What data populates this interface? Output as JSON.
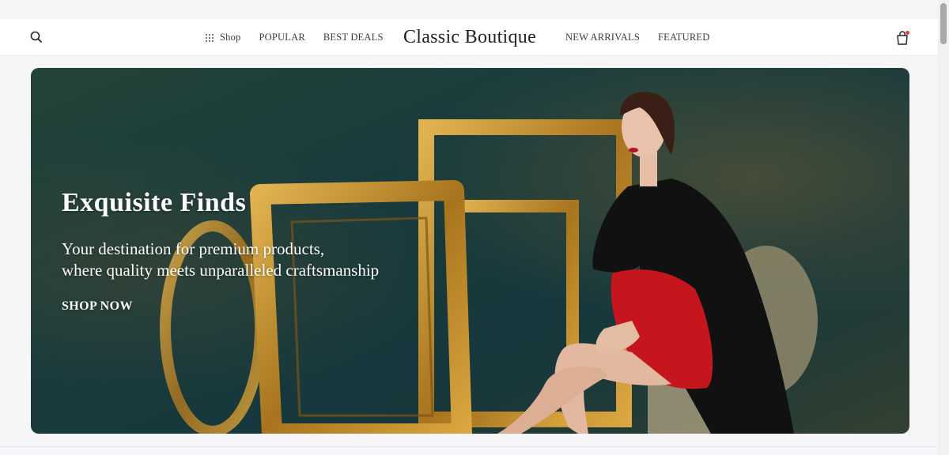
{
  "header": {
    "logo": "Classic Boutique",
    "nav_left": [
      {
        "label": "Shop",
        "icon": "grid-icon"
      },
      {
        "label": "POPULAR"
      },
      {
        "label": "BEST DEALS"
      }
    ],
    "nav_right": [
      {
        "label": "NEW ARRIVALS"
      },
      {
        "label": "FEATURED"
      }
    ],
    "search_icon": "search-icon",
    "cart_icon": "shopping-bag-icon",
    "cart_badge_color": "#e53b3b"
  },
  "hero": {
    "title": "Exquisite Finds",
    "subtitle_line1": "Your destination for premium products,",
    "subtitle_line2": "where quality meets unparalleled craftsmanship",
    "cta": "SHOP NOW"
  },
  "colors": {
    "hero_wall": "#1f4a48",
    "frame_gold": "#b8872a",
    "dress_red": "#c4161c",
    "coat_black": "#111111"
  }
}
